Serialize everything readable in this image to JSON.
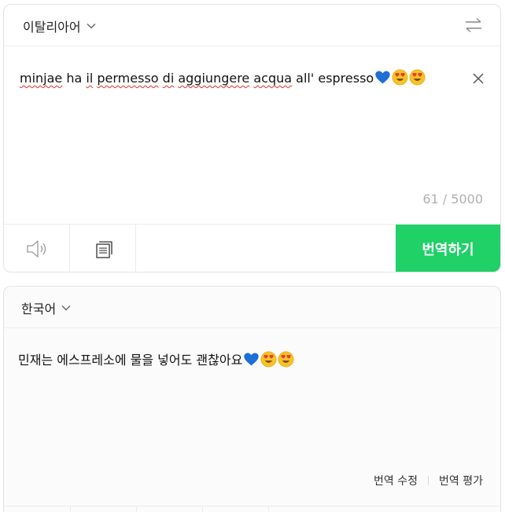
{
  "source": {
    "language": "이탈리아어",
    "text_segments": [
      {
        "text": "minjae",
        "underline": true
      },
      {
        "text": " ha ",
        "underline": false
      },
      {
        "text": "il",
        "underline": true
      },
      {
        "text": " ",
        "underline": false
      },
      {
        "text": "permesso",
        "underline": true
      },
      {
        "text": " ",
        "underline": false
      },
      {
        "text": "di",
        "underline": true
      },
      {
        "text": " ",
        "underline": false
      },
      {
        "text": "aggiungere",
        "underline": true
      },
      {
        "text": " ",
        "underline": false
      },
      {
        "text": "acqua",
        "underline": true
      },
      {
        "text": " all' espresso",
        "underline": false
      }
    ],
    "emojis": [
      "blue-heart",
      "heart-eyes",
      "heart-eyes"
    ],
    "char_count": "61 / 5000",
    "translate_button": "번역하기",
    "icons": {
      "speaker": "speaker-icon",
      "copy": "copy-icon",
      "clear": "close-icon",
      "swap": "swap-icon",
      "dropdown": "chevron-down-icon"
    }
  },
  "target": {
    "language": "한국어",
    "text": "민재는 에스프레소에 물을 넣어도 괜찮아요",
    "emojis": [
      "blue-heart",
      "heart-eyes",
      "heart-eyes"
    ],
    "actions": {
      "edit": "번역 수정",
      "rate": "번역 평가"
    }
  },
  "colors": {
    "accent": "#1fd167",
    "spellcheck": "#e03030",
    "muted": "#b0b0b0"
  }
}
